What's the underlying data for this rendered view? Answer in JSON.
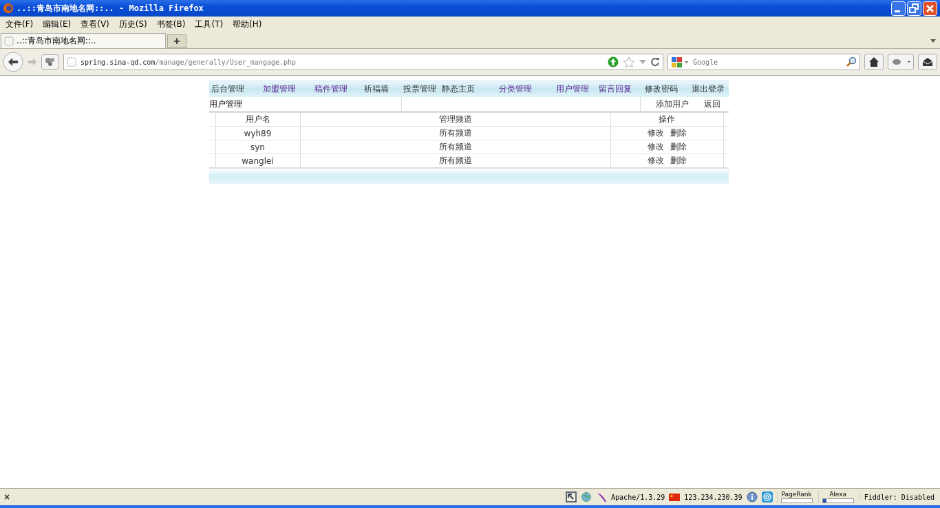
{
  "window": {
    "title": "..::青岛市南地名网::.. - Mozilla Firefox"
  },
  "menu_bar": [
    "文件(F)",
    "编辑(E)",
    "查看(V)",
    "历史(S)",
    "书签(B)",
    "工具(T)",
    "帮助(H)"
  ],
  "tabs": [
    {
      "label": "..::青岛市南地名网::..",
      "selected": true
    }
  ],
  "new_tab": "+",
  "address_bar": {
    "value_host": "spring.sina-qd.com",
    "value_path": "/manage/generally/User_mangage.php"
  },
  "search": {
    "placeholder": "Google"
  },
  "nav": [
    {
      "label": "后台管理",
      "visited": false
    },
    {
      "label": "加盟管理",
      "visited": true
    },
    {
      "label": "稿件管理",
      "visited": true
    },
    {
      "label": "祈福墙",
      "visited": false
    },
    {
      "label": "投票管理",
      "visited": false
    },
    {
      "label": "静态主页",
      "visited": false
    },
    {
      "label": "分类管理",
      "visited": true
    },
    {
      "label": "用户管理",
      "visited": true
    },
    {
      "label": "留言回复",
      "visited": true
    },
    {
      "label": "修改密码",
      "visited": false
    },
    {
      "label": "退出登录",
      "visited": false
    }
  ],
  "section": {
    "title": "用户管理",
    "actions": [
      "添加用户",
      "返回"
    ]
  },
  "table": {
    "columns": [
      "用户名",
      "管理频道",
      "操作"
    ],
    "rows": [
      {
        "username": "wyh89",
        "channel": "所有频道",
        "actions": [
          "修改",
          "删除"
        ]
      },
      {
        "username": "syn",
        "channel": "所有频道",
        "actions": [
          "修改",
          "删除"
        ]
      },
      {
        "username": "wanglei",
        "channel": "所有频道",
        "actions": [
          "修改",
          "删除"
        ]
      }
    ]
  },
  "status_bar": {
    "close": "×",
    "server": "Apache/1.3.29",
    "ip": "123.234.230.39",
    "meters": [
      {
        "label": "PageRank",
        "level": 0
      },
      {
        "label": "Alexa",
        "level": 0.12
      }
    ],
    "fiddler": "Fiddler: Disabled"
  }
}
